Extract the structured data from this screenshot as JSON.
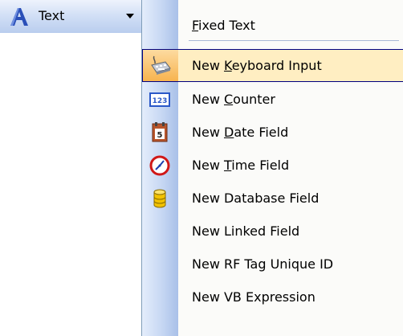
{
  "toolbar": {
    "button_label": "Text",
    "button_icon": "text-a-icon"
  },
  "menu": {
    "fixed_text": {
      "prefix": "",
      "mnemonic": "F",
      "suffix": "ixed Text"
    },
    "items": [
      {
        "prefix": "New ",
        "mnemonic": "K",
        "suffix": "eyboard Input",
        "icon": "keyboard-input-icon"
      },
      {
        "prefix": "New ",
        "mnemonic": "C",
        "suffix": "ounter",
        "icon": "counter-icon",
        "icon_text": "123"
      },
      {
        "prefix": "New ",
        "mnemonic": "D",
        "suffix": "ate Field",
        "icon": "calendar-icon",
        "icon_text": "5"
      },
      {
        "prefix": "New ",
        "mnemonic": "T",
        "suffix": "ime Field",
        "icon": "clock-icon"
      },
      {
        "prefix": "New Database Field",
        "mnemonic": "",
        "suffix": "",
        "icon": "database-icon"
      },
      {
        "prefix": "New Linked Field",
        "mnemonic": "",
        "suffix": "",
        "icon": ""
      },
      {
        "prefix": "New RF Tag Unique ID",
        "mnemonic": "",
        "suffix": "",
        "icon": ""
      },
      {
        "prefix": "New VB Expression",
        "mnemonic": "",
        "suffix": "",
        "icon": ""
      }
    ]
  },
  "colors": {
    "highlight_bg": "#ffeec2",
    "highlight_border": "#000080",
    "gutter": "#c6d7f3"
  }
}
